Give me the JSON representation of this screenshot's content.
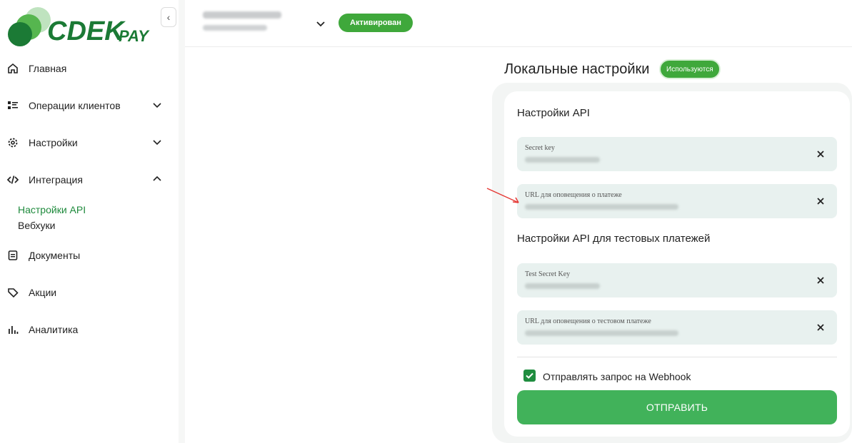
{
  "brand": {
    "name": "CDEK",
    "suffix": "PAY",
    "accent": "#1e8a3c",
    "green": "#3fa83b"
  },
  "sidebar": {
    "collapse_icon": "chevron-left-icon",
    "items": [
      {
        "label": "Главная",
        "icon": "home-icon"
      },
      {
        "label": "Операции клиентов",
        "icon": "operations-icon",
        "expand": "chevron-down-icon"
      },
      {
        "label": "Настройки",
        "icon": "gear-icon",
        "expand": "chevron-down-icon"
      },
      {
        "label": "Интеграция",
        "icon": "code-icon",
        "expand": "chevron-up-icon"
      },
      {
        "label": "Документы",
        "icon": "document-icon"
      },
      {
        "label": "Акции",
        "icon": "tag-icon"
      },
      {
        "label": "Аналитика",
        "icon": "chart-icon"
      }
    ],
    "integration_sub": [
      {
        "label": "Настройки API",
        "active": true
      },
      {
        "label": "Вебхуки",
        "active": false
      }
    ]
  },
  "header": {
    "status": "Активирован"
  },
  "main": {
    "title": "Локальные настройки",
    "badge": "Используются",
    "api_heading": "Настройки API",
    "test_heading": "Настройки API для тестовых платежей",
    "fields": [
      {
        "label": "Secret key"
      },
      {
        "label": "URL для оповещения о платеже"
      },
      {
        "label": "Test Secret Key"
      },
      {
        "label": "URL для оповещения о тестовом платеже"
      }
    ],
    "webhook_checkbox": {
      "label": "Отправлять запрос на Webhook",
      "checked": true
    },
    "submit_label": "ОТПРАВИТЬ"
  }
}
